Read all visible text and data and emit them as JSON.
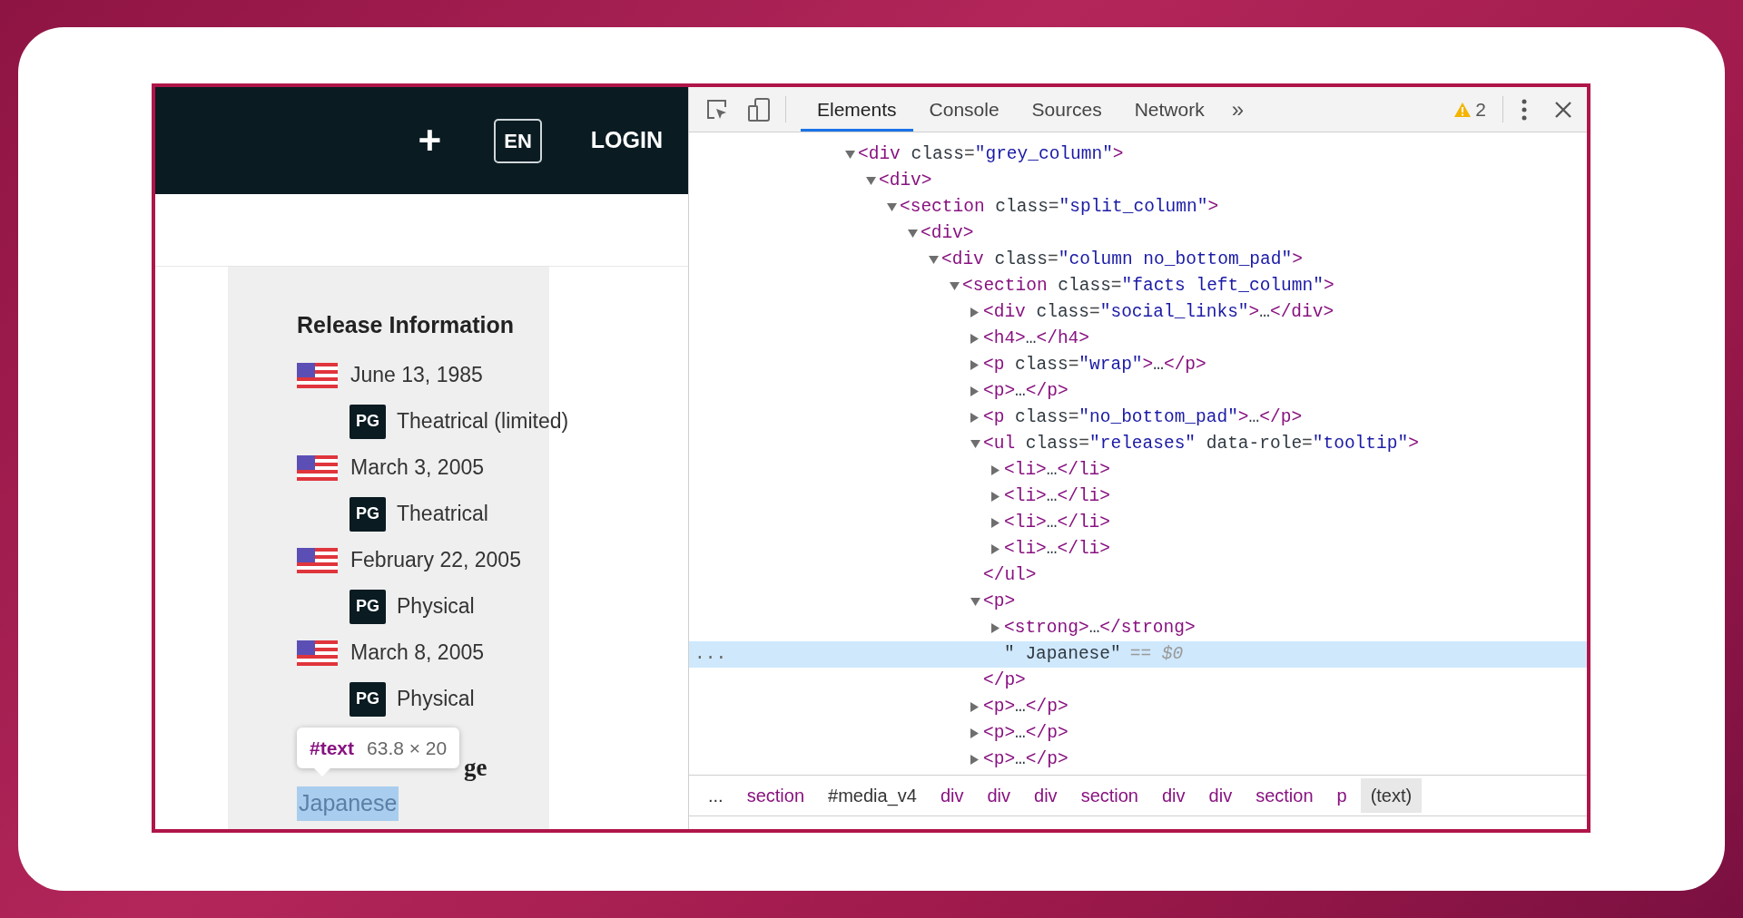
{
  "webpage": {
    "header": {
      "add": "+",
      "language": "EN",
      "login": "LOGIN"
    },
    "section_title": "Release Information",
    "releases": [
      {
        "date": "June 13, 1985",
        "rating": "PG",
        "type": "Theatrical (limited)"
      },
      {
        "date": "March 3, 2005",
        "rating": "PG",
        "type": "Theatrical"
      },
      {
        "date": "February 22, 2005",
        "rating": "PG",
        "type": "Physical"
      },
      {
        "date": "March 8, 2005",
        "rating": "PG",
        "type": "Physical"
      }
    ],
    "hover_tooltip": {
      "tag": "#text",
      "size": "63.8 × 20"
    },
    "partial_heading": "ge",
    "language": {
      "text": "Japanese",
      "highlighted": true
    }
  },
  "devtools": {
    "tabs": [
      {
        "label": "Elements",
        "selected": true
      },
      {
        "label": "Console",
        "selected": false
      },
      {
        "label": "Sources",
        "selected": false
      },
      {
        "label": "Network",
        "selected": false
      }
    ],
    "more_tabs": "»",
    "warnings": "2",
    "tree": [
      {
        "text": "<div class=\"grey_column\">",
        "expanded": true,
        "selected": false,
        "children": [
          {
            "text": "<div>",
            "expanded": true,
            "selected": false,
            "children": [
              {
                "text": "<section class=\"split_column\">",
                "expanded": true,
                "selected": false,
                "children": [
                  {
                    "text": "<div>",
                    "expanded": true,
                    "selected": false,
                    "children": [
                      {
                        "text": "<div class=\"column no_bottom_pad\">",
                        "expanded": true,
                        "selected": false,
                        "children": [
                          {
                            "text": "<section class=\"facts left_column\">",
                            "expanded": true,
                            "selected": false,
                            "children": [
                              {
                                "text": "<div class=\"social_links\">…</div>",
                                "expanded": false,
                                "selected": false
                              },
                              {
                                "text": "<h4>…</h4>",
                                "expanded": false,
                                "selected": false
                              },
                              {
                                "text": "<p class=\"wrap\">…</p>",
                                "expanded": false,
                                "selected": false
                              },
                              {
                                "text": "<p>…</p>",
                                "expanded": false,
                                "selected": false
                              },
                              {
                                "text": "<p class=\"no_bottom_pad\">…</p>",
                                "expanded": false,
                                "selected": false
                              },
                              {
                                "text": "<ul class=\"releases\" data-role=\"tooltip\">",
                                "expanded": true,
                                "selected": false,
                                "closing": "</ul>",
                                "children": [
                                  {
                                    "text": "<li>…</li>",
                                    "expanded": false,
                                    "selected": false
                                  },
                                  {
                                    "text": "<li>…</li>",
                                    "expanded": false,
                                    "selected": false
                                  },
                                  {
                                    "text": "<li>…</li>",
                                    "expanded": false,
                                    "selected": false
                                  },
                                  {
                                    "text": "<li>…</li>",
                                    "expanded": false,
                                    "selected": false
                                  }
                                ]
                              },
                              {
                                "text": "<p>",
                                "expanded": true,
                                "selected": false,
                                "closing": "</p>",
                                "children": [
                                  {
                                    "text": "<strong>…</strong>",
                                    "expanded": false,
                                    "selected": false
                                  },
                                  {
                                    "kind": "text",
                                    "text": "\" Japanese\"",
                                    "suffix": "== $0",
                                    "gutter": "...",
                                    "selected": true
                                  }
                                ]
                              },
                              {
                                "text": "<p>…</p>",
                                "expanded": false,
                                "selected": false
                              },
                              {
                                "text": "<p>…</p>",
                                "expanded": false,
                                "selected": false
                              },
                              {
                                "text": "<p>…</p>",
                                "expanded": false,
                                "selected": false
                              }
                            ]
                          }
                        ]
                      }
                    ]
                  }
                ]
              }
            ]
          }
        ]
      }
    ],
    "breadcrumbs": [
      {
        "kind": "more",
        "label": "...",
        "selected": false
      },
      {
        "kind": "tag",
        "label": "section",
        "selected": false
      },
      {
        "kind": "id",
        "label": "#media_v4",
        "selected": false
      },
      {
        "kind": "tag",
        "label": "div",
        "selected": false
      },
      {
        "kind": "tag",
        "label": "div",
        "selected": false
      },
      {
        "kind": "tag",
        "label": "div",
        "selected": false
      },
      {
        "kind": "tag",
        "label": "section",
        "selected": false
      },
      {
        "kind": "tag",
        "label": "div",
        "selected": false
      },
      {
        "kind": "tag",
        "label": "div",
        "selected": false
      },
      {
        "kind": "tag",
        "label": "section",
        "selected": false
      },
      {
        "kind": "tag",
        "label": "p",
        "selected": false
      },
      {
        "kind": "text",
        "label": "(text)",
        "selected": true
      }
    ]
  }
}
